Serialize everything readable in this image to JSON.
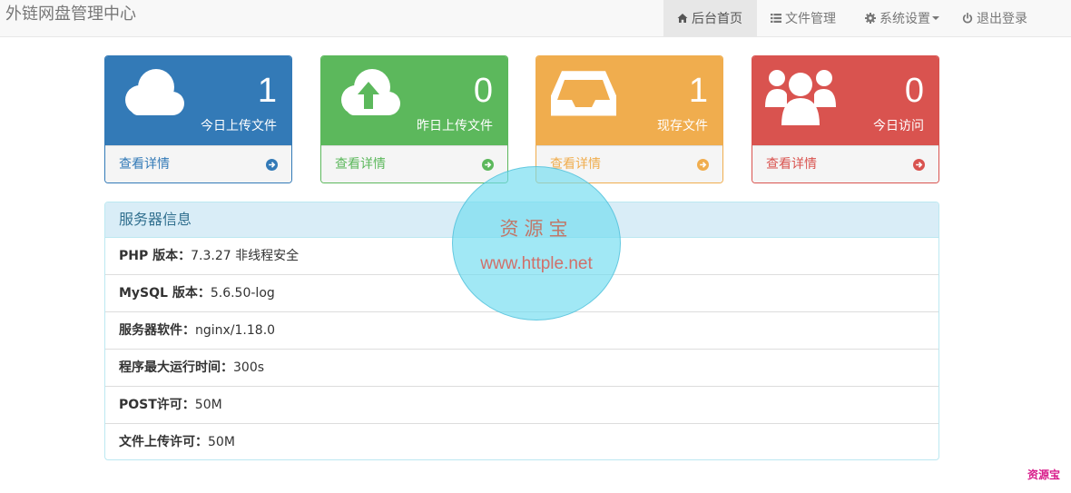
{
  "navbar": {
    "brand": "外链网盘管理中心",
    "items": [
      {
        "label": "后台首页",
        "icon": "home-icon",
        "active": true
      },
      {
        "label": "文件管理",
        "icon": "list-icon",
        "active": false
      },
      {
        "label": "系统设置",
        "icon": "gear-icon",
        "active": false,
        "dropdown": true
      },
      {
        "label": "退出登录",
        "icon": "power-icon",
        "active": false
      }
    ]
  },
  "stats": [
    {
      "count": "1",
      "label": "今日上传文件",
      "link": "查看详情",
      "icon": "cloud-icon",
      "color": "#337ab7"
    },
    {
      "count": "0",
      "label": "昨日上传文件",
      "link": "查看详情",
      "icon": "cloud-upload-icon",
      "color": "#5cb85c"
    },
    {
      "count": "1",
      "label": "现存文件",
      "link": "查看详情",
      "icon": "inbox-icon",
      "color": "#f0ad4e"
    },
    {
      "count": "0",
      "label": "今日访问",
      "link": "查看详情",
      "icon": "users-icon",
      "color": "#d9534f"
    }
  ],
  "server_info": {
    "title": "服务器信息",
    "rows": [
      {
        "key": "PHP 版本：",
        "value": "7.3.27 非线程安全"
      },
      {
        "key": "MySQL 版本：",
        "value": "5.6.50-log"
      },
      {
        "key": "服务器软件：",
        "value": "nginx/1.18.0"
      },
      {
        "key": "程序最大运行时间：",
        "value": "300s"
      },
      {
        "key": "POST许可：",
        "value": "50M"
      },
      {
        "key": "文件上传许可：",
        "value": "50M"
      }
    ]
  },
  "watermark": {
    "title": "资源宝",
    "url": "www.httple.net",
    "corner": "资源宝"
  }
}
